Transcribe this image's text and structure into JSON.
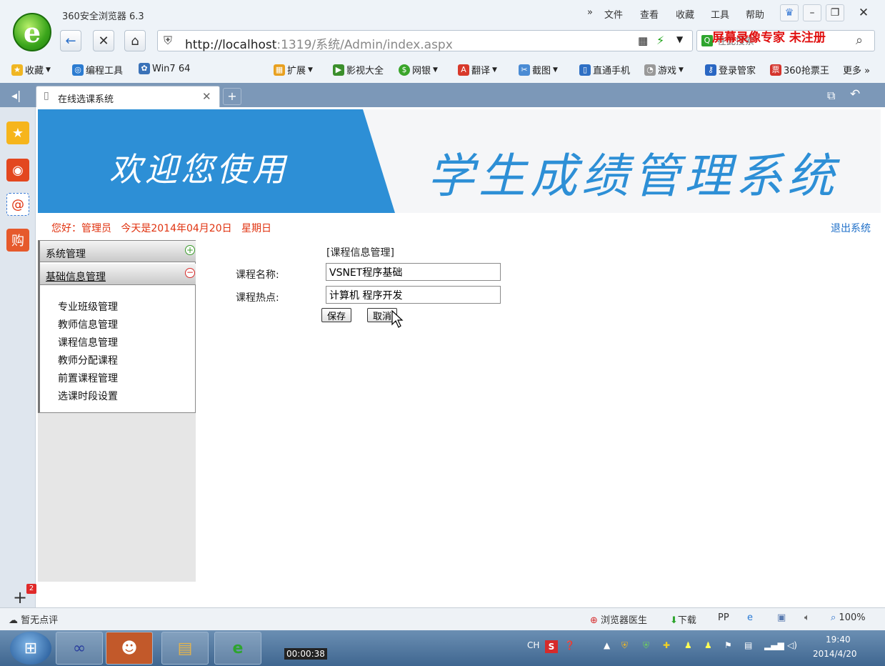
{
  "browser": {
    "title": "360安全浏览器 6.3",
    "menu": [
      "文件",
      "查看",
      "收藏",
      "工具",
      "帮助"
    ],
    "address_host": "http://localhost",
    "address_rest": ":1319/系统/Admin/index.aspx",
    "search_placeholder": "在此搜索",
    "recorder_mark": "屏幕录像专家 未注册",
    "bookmarks_left": [
      "收藏",
      "编程工具",
      "Win7 64"
    ],
    "bookmarks_right": [
      "扩展",
      "影视大全",
      "网银",
      "翻译",
      "截图",
      "直通手机",
      "游戏",
      "登录管家",
      "360抢票王",
      "更多 »"
    ],
    "tab_label": "在线选课系统"
  },
  "banner": {
    "left_text": "欢迎您使用",
    "right_text": "学生成绩管理系统",
    "accent": "#2d8fd6"
  },
  "header": {
    "greeting": "您好：管理员   今天是2014年04月20日   星期日",
    "logout": "退出系统"
  },
  "menu": {
    "group1": "系统管理",
    "group2": "基础信息管理",
    "items": [
      "专业班级管理",
      "教师信息管理",
      "课程信息管理",
      "教师分配课程",
      "前置课程管理",
      "选课时段设置"
    ]
  },
  "form": {
    "title": "[课程信息管理]",
    "name_label": "课程名称:",
    "name_value": "VSNET程序基础",
    "hot_label": "课程热点:",
    "hot_value": "计算机 程序开发",
    "save": "保存",
    "cancel": "取消"
  },
  "statusbar": {
    "left": "暂无点评",
    "doctor": "浏览器医生",
    "download": "下载",
    "zoom": "100%",
    "plus_badge": "2"
  },
  "taskbar": {
    "timer": "00:00:38",
    "lang": "CH",
    "time": "19:40",
    "date": "2014/4/20"
  }
}
